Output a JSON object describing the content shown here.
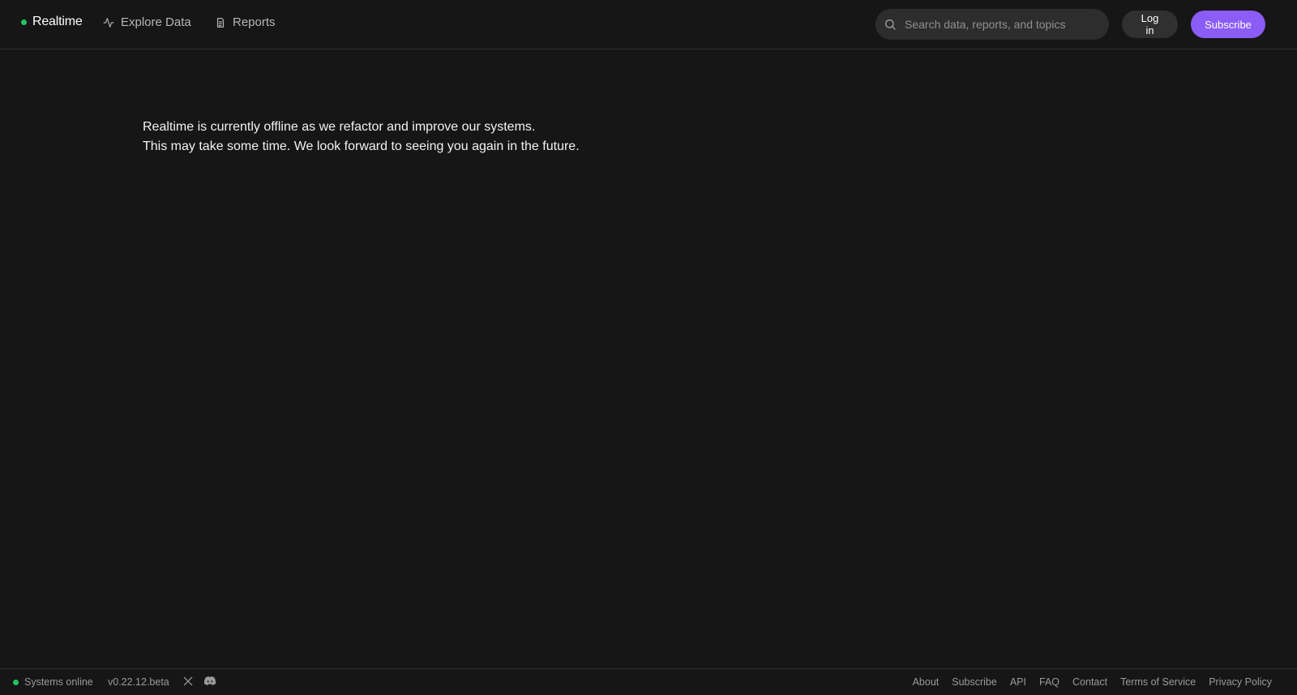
{
  "header": {
    "brand": "Realtime",
    "nav": {
      "explore": "Explore Data",
      "reports": "Reports"
    },
    "search": {
      "placeholder": "Search data, reports, and topics",
      "icon": "search-icon"
    },
    "login": "Log in",
    "subscribe": "Subscribe"
  },
  "main": {
    "line1": "Realtime is currently offline as we refactor and improve our systems.",
    "line2": "This may take some time. We look forward to seeing you again in the future."
  },
  "footer": {
    "status": "Systems online",
    "version": "v0.22.12.beta",
    "social": [
      "x-icon",
      "discord-icon"
    ],
    "links": {
      "about": "About",
      "subscribe": "Subscribe",
      "api": "API",
      "faq": "FAQ",
      "contact": "Contact",
      "terms": "Terms of Service",
      "privacy": "Privacy Policy"
    }
  },
  "colors": {
    "background": "#161616",
    "accent": "#8b5cf6",
    "status_green": "#22c55e"
  }
}
